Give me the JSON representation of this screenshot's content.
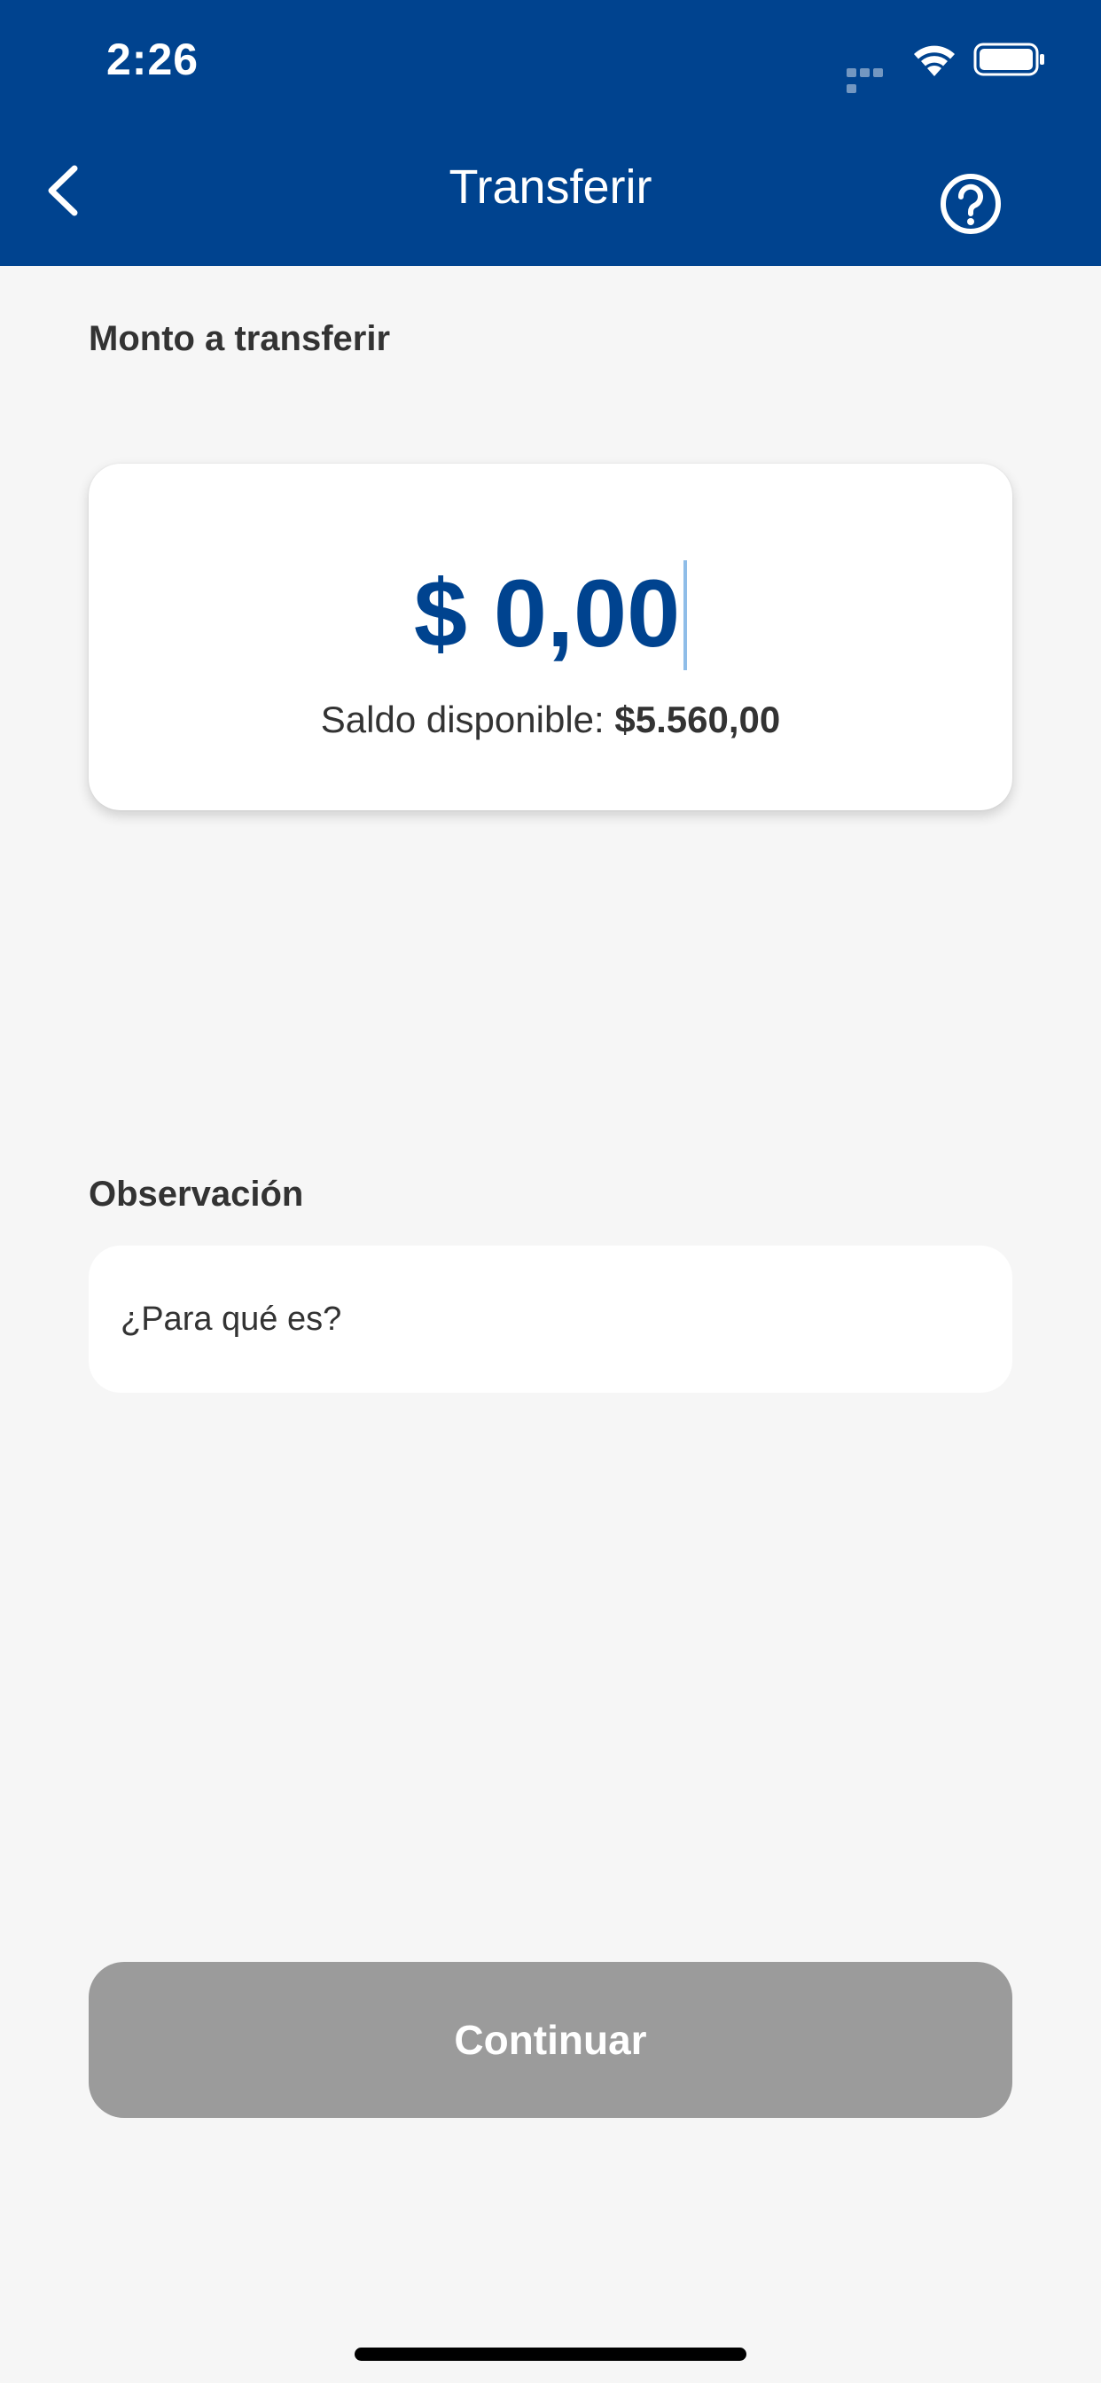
{
  "status_bar": {
    "time": "2:26"
  },
  "header": {
    "title": "Transferir",
    "background_color": "#00438f"
  },
  "amount_section": {
    "label": "Monto a transferir",
    "amount": "$ 0,00",
    "balance_label": "Saldo disponible:",
    "balance_value": "$5.560,00",
    "amount_color": "#00438f"
  },
  "note_section": {
    "label": "Observación",
    "placeholder": "¿Para qué es?",
    "value": ""
  },
  "continue_button": {
    "label": "Continuar",
    "state": "disabled",
    "color": "#9b9b9b"
  },
  "icons": {
    "back": "chevron-left-icon",
    "help": "question-circle-icon",
    "wifi": "wifi-icon",
    "battery": "battery-icon"
  }
}
